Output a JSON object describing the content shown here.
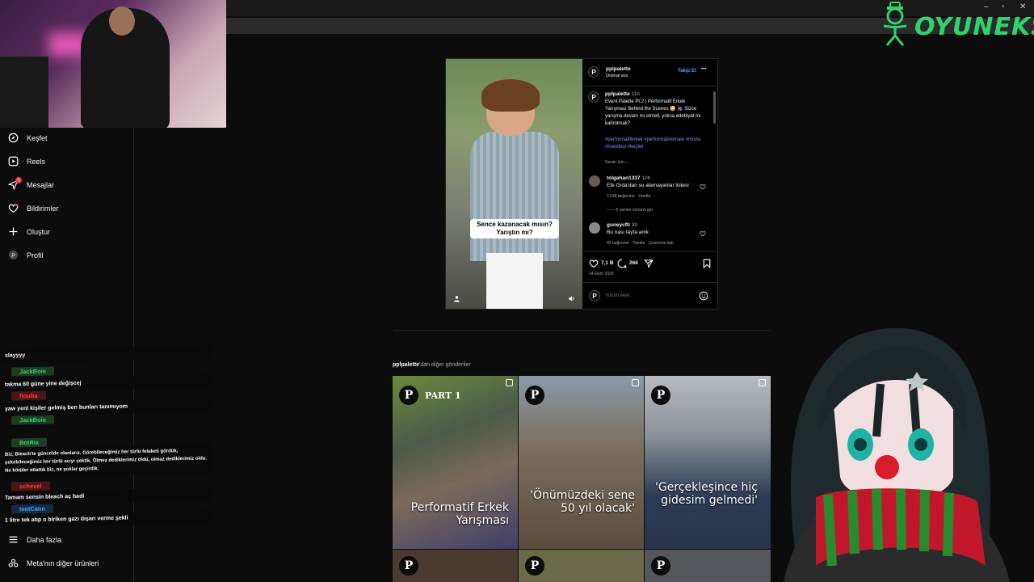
{
  "window": {
    "minimize": "–",
    "maximize": "▫",
    "close": "✕"
  },
  "logo": {
    "text": "OYUNEKS",
    "color": "#2fd36e"
  },
  "sidebar": {
    "items": [
      {
        "label": "Keşfet",
        "icon": "compass-icon"
      },
      {
        "label": "Reels",
        "icon": "reels-icon"
      },
      {
        "label": "Mesajlar",
        "icon": "messenger-icon",
        "badge": "5"
      },
      {
        "label": "Bildirimler",
        "icon": "heart-icon"
      },
      {
        "label": "Oluştur",
        "icon": "plus-icon"
      },
      {
        "label": "Profil",
        "icon": "profile-icon"
      }
    ],
    "bottom": [
      {
        "label": "Daha fazla",
        "icon": "menu-icon"
      },
      {
        "label": "Meta'nın diğer ürünleri",
        "icon": "meta-icon"
      }
    ]
  },
  "chat": {
    "messages": [
      {
        "type": "msg",
        "text": "slayyyy"
      },
      {
        "type": "name",
        "text": "JackBois",
        "color": "#3bd36b"
      },
      {
        "type": "msg",
        "text": "takma 60 güne yine değişcej"
      },
      {
        "type": "name",
        "text": "fiouba",
        "color": "#ff3b3b"
      },
      {
        "type": "msg",
        "text": "yaw yeni kişiler gelmiş ben bunları tanımıyom"
      },
      {
        "type": "name",
        "text": "JackBois",
        "color": "#3bd36b"
      },
      {
        "type": "name",
        "text": "BotRix",
        "color": "#3bd36b"
      },
      {
        "type": "msg",
        "text": "Biz, Bleach'te güncelde olanlarız. Görebileceğimiz her türlü felaketi gördük, çekebileceğimiz her türlü acıyı çektik. Ölmez dediklerimiz öldü, olmaz dediklerimiz oldu. Ne kötüler atlattık biz, ne şoklar geçirdik."
      },
      {
        "type": "name",
        "text": "schevel",
        "color": "#ff3b3b"
      },
      {
        "type": "msg",
        "text": "Tamam sensin bleach aç hadi"
      },
      {
        "type": "name",
        "text": "IsotCann",
        "color": "#4aa3ff"
      },
      {
        "type": "msg",
        "text": "1 litre tek atıp o biriken gazı dışarı verme şekli"
      }
    ]
  },
  "post": {
    "username": "pplpalette",
    "audio": "Orijinal ses",
    "follow": "Takip Et",
    "more": "•••",
    "overlay_text": "Sence kazanacak mısın? Yarıştın mı?",
    "caption_user": "pplpalette",
    "caption_time": "11h",
    "caption_text": "Event Palette Pt.2 | Performatif Erkek Yarışması Behind the Scenes 😳 🍇 Sizce yarışma devam mı etmeli, yoksa edebiyat mı kahrolmak?",
    "hashtags": "#performatiferkek #performativemale #moda #manifest #keşfet",
    "for_you": "Senin için",
    "comments": [
      {
        "user": "tolgahan1337",
        "time": "10h",
        "text": "Efe Gıda'dan su alamayanlar listesi",
        "likes": "2.038 beğenme",
        "reply": "Yanıtla",
        "view_replies": "6 yanıtın tümünü gör"
      },
      {
        "user": "guneycfti",
        "time": "3h",
        "text": "Bu nası tayfa amk",
        "likes": "45 beğenme",
        "reply": "Yanıtla",
        "translate": "Çevirisine bak"
      }
    ],
    "like_count": "7,1 B",
    "comment_count": "266",
    "date": "14 Ekim 2025",
    "comment_placeholder": "Yorum ekle..."
  },
  "more_posts": {
    "user": "pplpalette",
    "suffix": "'dan diğer gönderiler",
    "tiles": [
      {
        "tag": "PART 1",
        "text": "Performatif Erkek Yarışması"
      },
      {
        "text": "'Önümüzdeki sene 50 yıl olacak'"
      },
      {
        "text": "'Gerçekleşince hiç gidesim gelmedi'"
      }
    ]
  }
}
